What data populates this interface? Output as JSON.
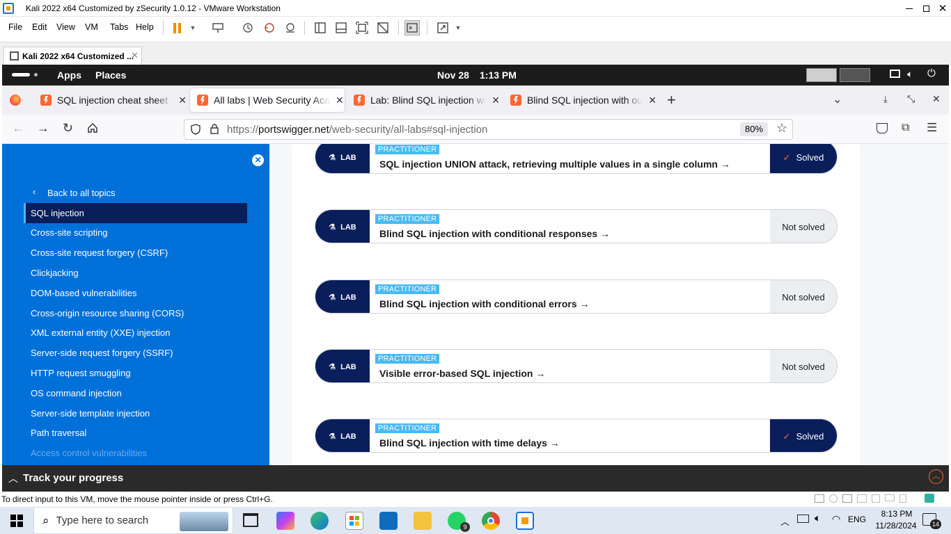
{
  "vmware": {
    "title": "Kali 2022 x64 Customized by zSecurity 1.0.12 - VMware Workstation",
    "menu": [
      "File",
      "Edit",
      "View",
      "VM",
      "Tabs",
      "Help"
    ],
    "tab_label": "Kali 2022 x64 Customized ...",
    "status_text": "To direct input to this VM, move the mouse pointer inside or press Ctrl+G."
  },
  "kali": {
    "apps": "Apps",
    "places": "Places",
    "date": "Nov 28",
    "time": "1:13 PM"
  },
  "firefox": {
    "tabs": [
      {
        "title": "SQL injection cheat sheet",
        "active": false
      },
      {
        "title": "All labs | Web Security Academy",
        "active": true
      },
      {
        "title": "Lab: Blind SQL injection with",
        "active": false
      },
      {
        "title": "Blind SQL injection with out-of-band",
        "active": false
      }
    ],
    "url_prefix": "https://",
    "url_host": "portswigger.net",
    "url_path": "/web-security/all-labs#sql-injection",
    "zoom": "80%"
  },
  "sidebar": {
    "back": "Back to all topics",
    "items": [
      {
        "label": "SQL injection",
        "active": true
      },
      {
        "label": "Cross-site scripting"
      },
      {
        "label": "Cross-site request forgery (CSRF)"
      },
      {
        "label": "Clickjacking"
      },
      {
        "label": "DOM-based vulnerabilities"
      },
      {
        "label": "Cross-origin resource sharing (CORS)"
      },
      {
        "label": "XML external entity (XXE) injection"
      },
      {
        "label": "Server-side request forgery (SSRF)"
      },
      {
        "label": "HTTP request smuggling"
      },
      {
        "label": "OS command injection"
      },
      {
        "label": "Server-side template injection"
      },
      {
        "label": "Path traversal"
      },
      {
        "label": "Access control vulnerabilities"
      }
    ]
  },
  "labs": [
    {
      "tag": "LAB",
      "level": "PRACTITIONER",
      "title": "SQL injection UNION attack, retrieving multiple values in a single column",
      "status": "Solved"
    },
    {
      "tag": "LAB",
      "level": "PRACTITIONER",
      "title": "Blind SQL injection with conditional responses",
      "status": "Not solved"
    },
    {
      "tag": "LAB",
      "level": "PRACTITIONER",
      "title": "Blind SQL injection with conditional errors",
      "status": "Not solved"
    },
    {
      "tag": "LAB",
      "level": "PRACTITIONER",
      "title": "Visible error-based SQL injection",
      "status": "Not solved"
    },
    {
      "tag": "LAB",
      "level": "PRACTITIONER",
      "title": "Blind SQL injection with time delays",
      "status": "Solved"
    }
  ],
  "track": {
    "label": "Track your progress"
  },
  "taskbar": {
    "search_placeholder": "Type here to search",
    "time": "8:13 PM",
    "date": "11/28/2024",
    "lang": "ENG",
    "whatsapp_badge": "9",
    "notif_count": "14"
  },
  "colors": {
    "sidebar": "#0070d9",
    "navy": "#0a1e5c",
    "badge": "#48b9f5",
    "kali_bar": "#1c1c1c"
  }
}
